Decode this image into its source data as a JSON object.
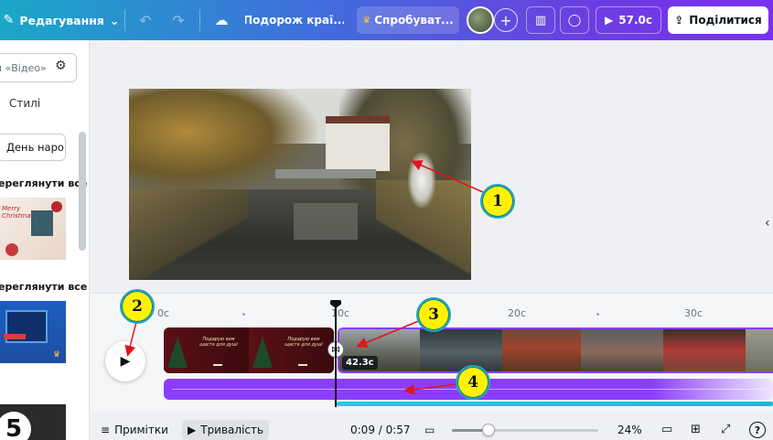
{
  "topbar": {
    "edit_menu_label": "Редагування",
    "document_title": "Подорож краї...",
    "try_label": "Спробуват...",
    "play_duration": "57.0с",
    "share_label": "Поділитися"
  },
  "left_panel": {
    "search_placeholder": "ом «Відео»",
    "styles_label": "Стилі",
    "chip_label": "День наро",
    "see_all_1": "ереглянути все",
    "see_all_2": "ереглянути все",
    "thumb1_text": "Merry Christmas",
    "thumb3_number": "5"
  },
  "timeline": {
    "ticks": [
      "0с",
      "10с",
      "20с",
      "30с"
    ],
    "clip1_text": "Подарую вам щастя для душі",
    "clip2_duration": "42.3с"
  },
  "bottombar": {
    "notes_label": "Примітки",
    "duration_label": "Тривалість",
    "time": "0:09 / 0:57",
    "zoom": "24%",
    "help": "?"
  },
  "callouts": [
    "1",
    "2",
    "3",
    "4"
  ],
  "colors": {
    "accent": "#8b3dff",
    "callout_fill": "#fff200",
    "callout_border": "#1aa8c6",
    "arrow": "#e0141e",
    "audio_secondary": "#2ec4e8"
  },
  "icons": {
    "pencil": "pencil-icon",
    "undo": "undo-icon",
    "redo": "redo-icon",
    "cloud": "cloud-saved-icon",
    "crown": "crown-icon",
    "stats": "bar-chart-icon",
    "comment": "comment-icon",
    "play": "play-icon",
    "share": "share-icon",
    "filter": "filter-icon"
  }
}
